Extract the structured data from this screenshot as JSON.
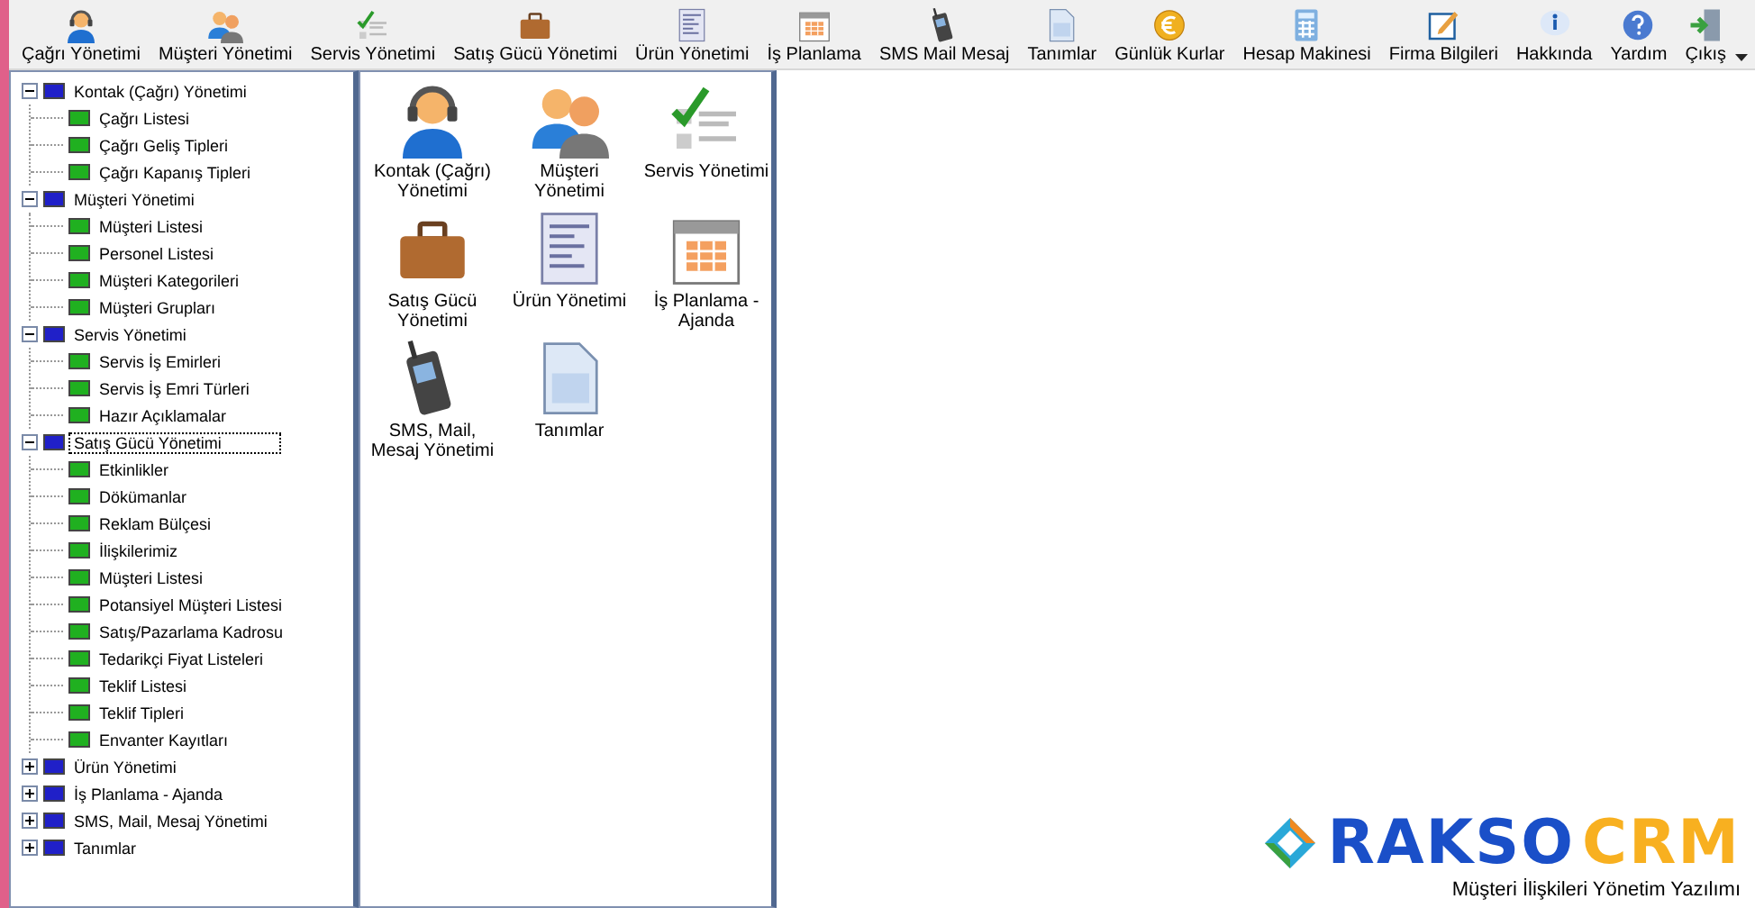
{
  "toolbar": [
    {
      "label": "Çağrı Yönetimi"
    },
    {
      "label": "Müşteri Yönetimi"
    },
    {
      "label": "Servis Yönetimi"
    },
    {
      "label": "Satış Gücü Yönetimi"
    },
    {
      "label": "Ürün Yönetimi"
    },
    {
      "label": "İş Planlama"
    },
    {
      "label": "SMS Mail Mesaj"
    },
    {
      "label": "Tanımlar"
    },
    {
      "label": "Günlük Kurlar"
    },
    {
      "label": "Hesap Makinesi"
    },
    {
      "label": "Firma Bilgileri"
    },
    {
      "label": "Hakkında"
    },
    {
      "label": "Yardım"
    },
    {
      "label": "Çıkış"
    }
  ],
  "tree": [
    {
      "label": "Kontak (Çağrı) Yönetimi",
      "expanded": true,
      "selected": false,
      "children": [
        {
          "label": "Çağrı Listesi"
        },
        {
          "label": "Çağrı Geliş Tipleri"
        },
        {
          "label": "Çağrı Kapanış Tipleri"
        }
      ]
    },
    {
      "label": "Müşteri Yönetimi",
      "expanded": true,
      "selected": false,
      "children": [
        {
          "label": "Müşteri Listesi"
        },
        {
          "label": "Personel Listesi"
        },
        {
          "label": "Müşteri Kategorileri"
        },
        {
          "label": "Müşteri Grupları"
        }
      ]
    },
    {
      "label": "Servis Yönetimi",
      "expanded": true,
      "selected": false,
      "children": [
        {
          "label": "Servis İş Emirleri"
        },
        {
          "label": "Servis İş Emri Türleri"
        },
        {
          "label": "Hazır Açıklamalar"
        }
      ]
    },
    {
      "label": "Satış Gücü Yönetimi",
      "expanded": true,
      "selected": true,
      "children": [
        {
          "label": "Etkinlikler"
        },
        {
          "label": "Dökümanlar"
        },
        {
          "label": "Reklam Bülçesi"
        },
        {
          "label": "İlişkilerimiz"
        },
        {
          "label": "Müşteri Listesi"
        },
        {
          "label": "Potansiyel Müşteri Listesi"
        },
        {
          "label": "Satış/Pazarlama Kadrosu"
        },
        {
          "label": "Tedarikçi Fiyat Listeleri"
        },
        {
          "label": "Teklif Listesi"
        },
        {
          "label": "Teklif Tipleri"
        },
        {
          "label": "Envanter Kayıtları"
        }
      ]
    },
    {
      "label": "Ürün Yönetimi",
      "expanded": false,
      "selected": false
    },
    {
      "label": "İş Planlama - Ajanda",
      "expanded": false,
      "selected": false
    },
    {
      "label": "SMS, Mail, Mesaj Yönetimi",
      "expanded": false,
      "selected": false
    },
    {
      "label": "Tanımlar",
      "expanded": false,
      "selected": false
    }
  ],
  "modules": [
    {
      "label": "Kontak (Çağrı) Yönetimi"
    },
    {
      "label": "Müşteri Yönetimi"
    },
    {
      "label": "Servis Yönetimi"
    },
    {
      "label": "Satış Gücü Yönetimi"
    },
    {
      "label": "Ürün Yönetimi"
    },
    {
      "label": "İş Planlama - Ajanda"
    },
    {
      "label": "SMS, Mail, Mesaj Yönetimi"
    },
    {
      "label": "Tanımlar"
    }
  ],
  "logo": {
    "brand_first": "RAKSO",
    "brand_second": "CRM",
    "tagline": "Müşteri İlişkileri Yönetim Yazılımı"
  }
}
